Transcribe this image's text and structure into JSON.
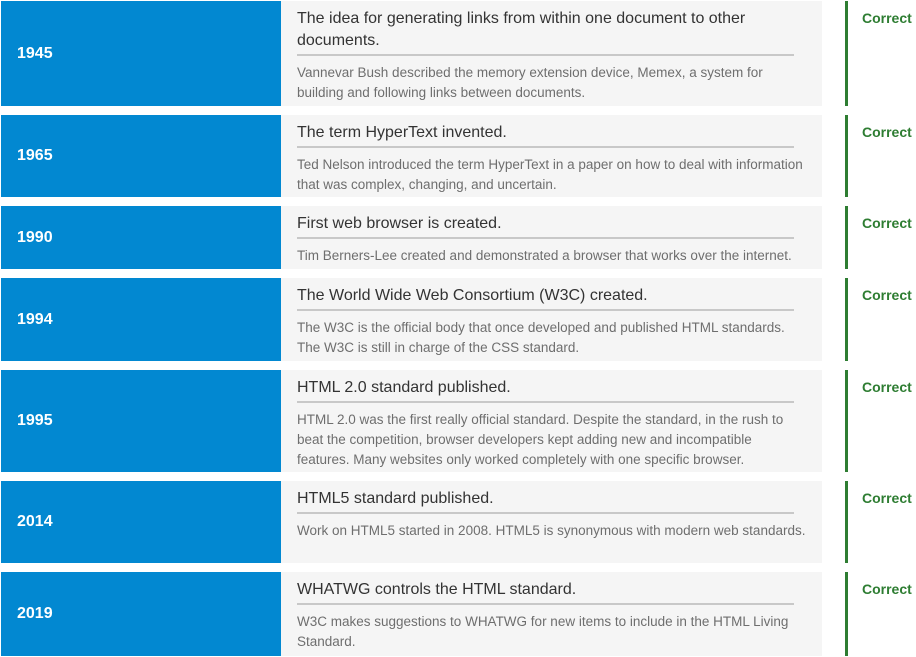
{
  "colors": {
    "year_bg": "#0288d1",
    "card_bg": "#f5f5f5",
    "correct": "#2e7d32"
  },
  "events": [
    {
      "year": "1945",
      "title": "The idea for generating links from within one document to other documents.",
      "description": "Vannevar Bush described the memory extension device, Memex, a system for building and following links between documents.",
      "result": "Correct"
    },
    {
      "year": "1965",
      "title": "The term HyperText invented.",
      "description": "Ted Nelson introduced the term HyperText in a paper on how to deal with information that was complex, changing, and uncertain.",
      "result": "Correct"
    },
    {
      "year": "1990",
      "title": "First web browser is created.",
      "description": "Tim Berners-Lee created and demonstrated a browser that works over the internet.",
      "result": "Correct"
    },
    {
      "year": "1994",
      "title": "The World Wide Web Consortium (W3C) created.",
      "description": "The W3C is the official body that once developed and published HTML standards. The W3C is still in charge of the CSS standard.",
      "result": "Correct"
    },
    {
      "year": "1995",
      "title": "HTML 2.0 standard published.",
      "description": "HTML 2.0 was the first really official standard. Despite the standard, in the rush to beat the competition, browser developers kept adding new and incompatible features. Many websites only worked completely with one specific browser.",
      "result": "Correct"
    },
    {
      "year": "2014",
      "title": "HTML5 standard published.",
      "description": "Work on HTML5 started in 2008. HTML5 is synonymous with modern web standards.",
      "result": "Correct"
    },
    {
      "year": "2019",
      "title": "WHATWG controls the HTML standard.",
      "description": "W3C makes suggestions to WHATWG for new items to include in the HTML Living Standard.",
      "result": "Correct"
    }
  ]
}
